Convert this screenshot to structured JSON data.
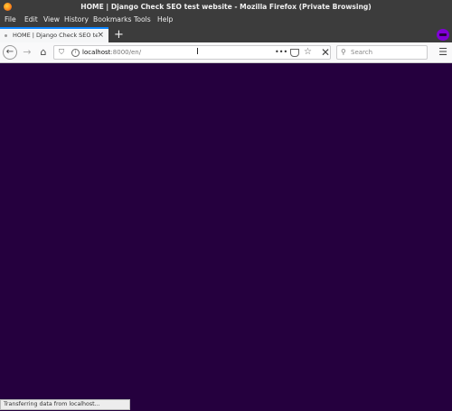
{
  "window": {
    "title": "HOME | Django Check SEO test website - Mozilla Firefox (Private Browsing)"
  },
  "menu": [
    "File",
    "Edit",
    "View",
    "History",
    "Bookmarks",
    "Tools",
    "Help"
  ],
  "tab": {
    "title": "HOME | Django Check SEO test website"
  },
  "urlbar": {
    "host": "localhost",
    "path": ":8000/en/"
  },
  "search": {
    "placeholder": "Search"
  },
  "status": "Transferring data from localhost...",
  "colors": {
    "chrome": "#3c3c3c",
    "content": "#25003e",
    "accent": "#0a84ff",
    "private": "#8000d7"
  },
  "icons": [
    "firefox-icon",
    "close-icon",
    "new-tab-icon",
    "private-browsing-icon",
    "back-arrow-icon",
    "forward-arrow-icon",
    "home-icon",
    "shield-icon",
    "info-icon",
    "page-actions-icon",
    "pocket-icon",
    "bookmark-star-icon",
    "stop-icon",
    "search-icon",
    "hamburger-menu-icon"
  ]
}
